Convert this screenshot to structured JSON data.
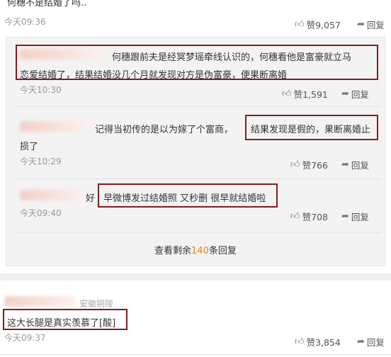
{
  "top_comment": {
    "text": "何穗不是结婚了吗..",
    "time": "今天09:36",
    "likes": "赞9,057",
    "reply": "回复"
  },
  "replies": [
    {
      "text_line1": "何穗跟前夫是经冥梦瑶牵线认识的，何穗看他是富豪就立马",
      "text_line2": "恋爱结婚了，结果结婚没几个月就发现对方是伪富豪，便果断离婚",
      "time": "今天10:30",
      "likes": "赞1,591",
      "reply": "回复"
    },
    {
      "text_line1_a": "记得当初传的是以为嫁了个富商，",
      "text_line1_b": "结果发现是假的，果断离婚止",
      "text_line2": "损了",
      "time": "今天10:29",
      "likes": "赞766",
      "reply": "回复"
    },
    {
      "text_prefix": "好",
      "text_boxed": "早微博发过结婚照 又秒删 很早就结婚啦",
      "time": "今天09:40",
      "likes": "赞708",
      "reply": "回复"
    }
  ],
  "view_more": {
    "prefix": "查看剩余",
    "count": "140",
    "suffix": "条回复"
  },
  "second_comment": {
    "location": "安徽铜陵",
    "text": "这大长腿是真实羡慕了[酸]",
    "time": "今天09:37",
    "likes": "赞3,854",
    "reply": "回复"
  },
  "icons": {
    "like": "thumbs-up-icon",
    "reply": "reply-arrow-icon"
  },
  "colors": {
    "highlight_box": "#7d1f1f",
    "count_orange": "#e5831d",
    "meta_gray": "#999999"
  }
}
